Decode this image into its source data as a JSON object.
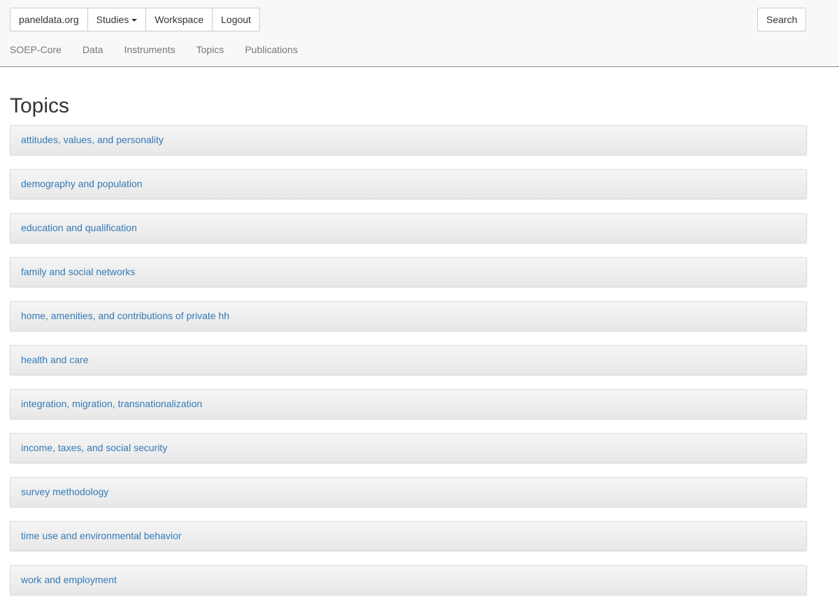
{
  "header": {
    "buttons": {
      "home": "paneldata.org",
      "studies": "Studies",
      "workspace": "Workspace",
      "logout": "Logout",
      "search": "Search"
    },
    "brand": "SOEP-Core",
    "nav": [
      "Data",
      "Instruments",
      "Topics",
      "Publications"
    ]
  },
  "main": {
    "title": "Topics",
    "topics": [
      "attitudes, values, and personality",
      "demography and population",
      "education and qualification",
      "family and social networks",
      "home, amenities, and contributions of private hh",
      "health and care",
      "integration, migration, transnationalization",
      "income, taxes, and social security",
      "survey methodology",
      "time use and environmental behavior",
      "work and employment"
    ]
  },
  "icons": {
    "studies_dropdown": "caret-down-icon"
  }
}
